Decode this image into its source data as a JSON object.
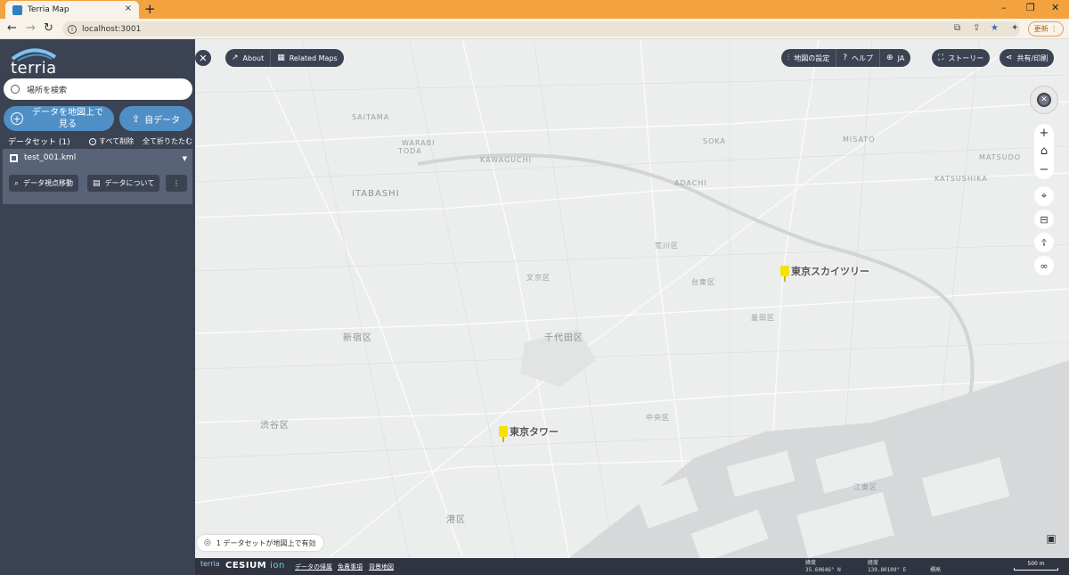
{
  "browser": {
    "tab_title": "Terria Map",
    "new_tab": "+",
    "tab_close": "×",
    "url": "localhost:3001",
    "update_label": "更新",
    "win_min": "–",
    "win_max": "❐",
    "win_close": "✕"
  },
  "sidebar": {
    "logo_text": "terria",
    "search_placeholder": "場所を検索",
    "explore_label": "データを地図上で見る",
    "upload_label": "自データ",
    "datasets_header": "データセット (1)",
    "remove_all": "すべて削除",
    "collapse_all": "全て折りたたむ",
    "item": {
      "name": "test_001.kml",
      "zoom_label": "データ視点移動",
      "about_label": "データについて",
      "more": "⋮"
    }
  },
  "toolbar": {
    "close": "✕",
    "about": "About",
    "related_maps": "Related Maps",
    "map_settings": "地図の設定",
    "help": "ヘルプ",
    "language": "JA",
    "story": "ストーリー",
    "share": "共有/印刷"
  },
  "map": {
    "labels": {
      "saitama": "SAITAMA",
      "soka": "SOKA",
      "misato": "MISATO",
      "warabi": "WARABI",
      "toda": "TODA",
      "kawaguchi": "KAWAGUCHI",
      "adachi": "ADACHI",
      "itabashi": "ITABASHI",
      "katsushika": "KATSUSHIKA",
      "matsudo": "MATSUDO",
      "arakawa": "荒川区",
      "bunkyo": "文京区",
      "taito": "台東区",
      "sumida": "墨田区",
      "shinjuku": "新宿区",
      "chiyoda": "千代田区",
      "chuo": "中央区",
      "shibuya": "渋谷区",
      "minato": "港区",
      "koto": "江東区"
    },
    "poi_skytree": "東京スカイツリー",
    "poi_tower": "東京タワー"
  },
  "status": {
    "workbench_count": "1 データセットが地図上で有効"
  },
  "bottom": {
    "terria": "terria",
    "cesium": "CESIUM",
    "ion": "ion",
    "link1": "データの帰属",
    "link2": "免責事項",
    "link3": "背景地図",
    "lat_label": "緯度",
    "lat_value": "35.60646° N",
    "lon_label": "経度",
    "lon_value": "139.80109° E",
    "elev_label": "標高",
    "scale": "500 m"
  },
  "colors": {
    "sidebar": "#3b4252",
    "accent": "#4f8fc5",
    "browser_tab": "#f3a240",
    "poi": "#f6e200"
  }
}
